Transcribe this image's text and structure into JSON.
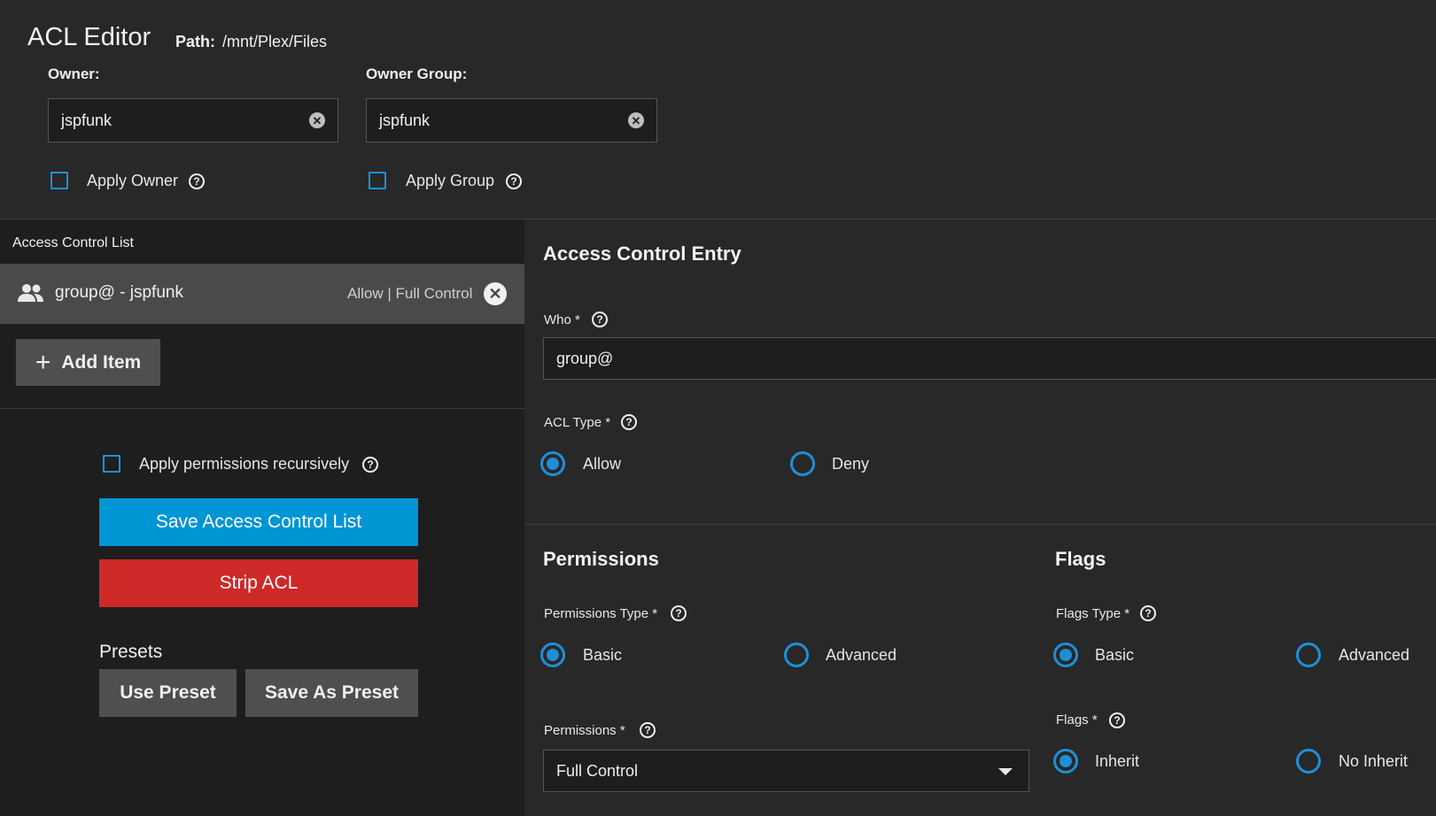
{
  "header": {
    "title": "ACL Editor",
    "path_label": "Path:",
    "path_value": "/mnt/Plex/Files"
  },
  "owner": {
    "label": "Owner:",
    "value": "jspfunk",
    "apply_label": "Apply Owner"
  },
  "owner_group": {
    "label": "Owner Group:",
    "value": "jspfunk",
    "apply_label": "Apply Group"
  },
  "acl_list": {
    "header": "Access Control List",
    "items": [
      {
        "name": "group@ - jspfunk",
        "summary": "Allow | Full Control",
        "icon": "group-icon"
      }
    ],
    "add_label": "Add Item"
  },
  "actions": {
    "recursive_label": "Apply permissions recursively",
    "save_label": "Save Access Control List",
    "strip_label": "Strip ACL",
    "presets_label": "Presets",
    "use_preset_label": "Use Preset",
    "save_preset_label": "Save As Preset"
  },
  "entry": {
    "title": "Access Control Entry",
    "who_label": "Who *",
    "who_value": "group@",
    "acl_type_label": "ACL Type *",
    "acl_type_options": [
      "Allow",
      "Deny"
    ],
    "acl_type_selected": "Allow"
  },
  "permissions": {
    "title": "Permissions",
    "type_label": "Permissions Type *",
    "type_options": [
      "Basic",
      "Advanced"
    ],
    "type_selected": "Basic",
    "perm_label": "Permissions *",
    "perm_value": "Full Control"
  },
  "flags": {
    "title": "Flags",
    "type_label": "Flags Type *",
    "type_options": [
      "Basic",
      "Advanced"
    ],
    "type_selected": "Basic",
    "flags_label": "Flags *",
    "flags_options": [
      "Inherit",
      "No Inherit"
    ],
    "flags_selected": "Inherit"
  },
  "colors": {
    "accent": "#1e8fd6",
    "save_button": "#0095d5",
    "strip_button": "#ce2929"
  }
}
